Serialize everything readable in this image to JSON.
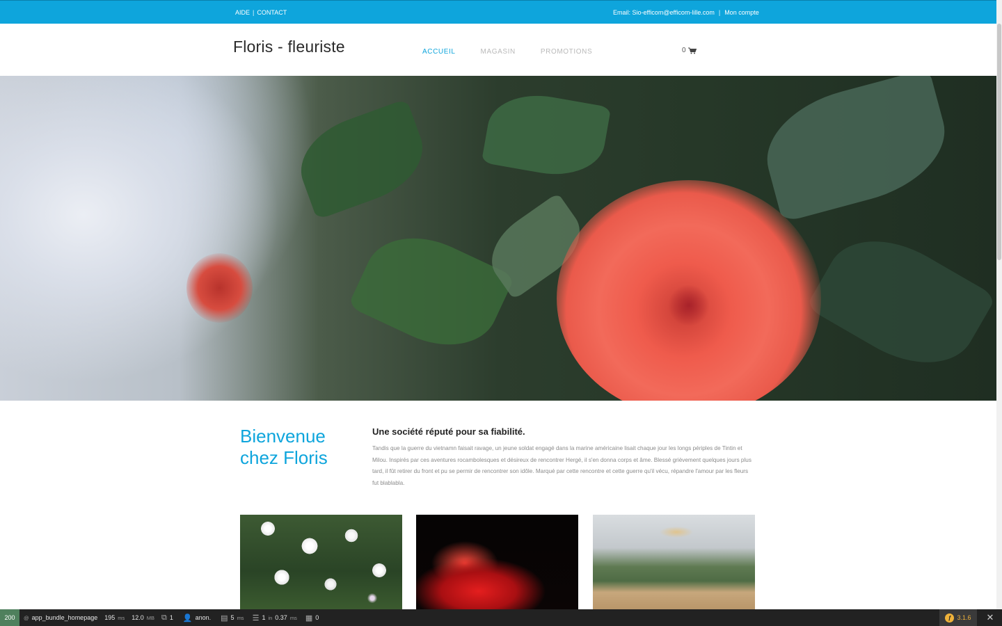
{
  "topbar": {
    "aide": "AIDE",
    "sep1": "|",
    "contact": "CONTACT",
    "email": "Email: Sio-efficom@efficom-lille.com",
    "sep2": "|",
    "account": "Mon compte",
    "color": "#0ea5dc"
  },
  "header": {
    "logo": "Floris - fleuriste",
    "nav": [
      "ACCUEIL",
      "MAGASIN",
      "PROMOTIONS"
    ],
    "active_nav": "ACCUEIL",
    "cart_count": "0",
    "cart_icon": "shopping-cart-icon"
  },
  "welcome": {
    "title": "Bienvenue chez Floris",
    "heading": "Une société réputé pour sa fiabilité.",
    "text": "Tandis que la guerre du vietnamn faisait ravage, un jeune soldat engagé dans la marine américaine lisait chaque jour les longs périples de Tintin et Milou. Inspirés par ces aventures rocambolesques et désireux de rencontrer Hergé, il s'en donna corps et âme. Blessé grièvement quelques jours plus tard, il fût retirer du front et pu se permir de rencontrer son idôle. Marqué par cette rencontre et cette guerre qu'il vécu, répandre l'amour par les fleurs fut blablabla."
  },
  "debug": {
    "status": "200",
    "route_prefix": "@",
    "route": "app_bundle_homepage",
    "time": "195",
    "time_unit": "ms",
    "memory": "12.0",
    "memory_unit": "MB",
    "forms": "1",
    "user": "anon.",
    "render": "5",
    "render_unit": "ms",
    "db_queries": "1",
    "db_in": "in",
    "db_time": "0.37",
    "db_unit": "ms",
    "twig": "0",
    "version": "3.1.6"
  }
}
